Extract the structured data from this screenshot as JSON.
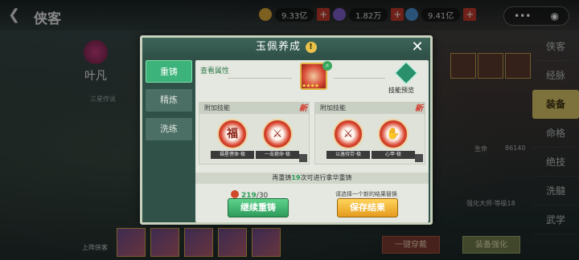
{
  "header": {
    "back_glyph": "❮",
    "title": "侠客",
    "resources": [
      {
        "name": "coin",
        "amount": "9.33亿",
        "color": "#d8a637"
      },
      {
        "name": "gem",
        "amount": "1.82万",
        "color": "#7a5cc8"
      },
      {
        "name": "jade",
        "amount": "9.41亿",
        "color": "#4b8fd1"
      }
    ],
    "plus_glyph": "+",
    "capsule_dots": "•••",
    "capsule_circle": "◉"
  },
  "right_tabs": [
    "侠客",
    "经脉",
    "装备",
    "命格",
    "绝技",
    "洗髓",
    "武学"
  ],
  "right_active": "装备",
  "hero": {
    "name": "叶凡",
    "subtitle": "三星传说"
  },
  "background_labels": {
    "stat": "生命",
    "stat_value": "86140",
    "master": "强化大师·等级18",
    "bottom_label": "上阵侠客",
    "one_key": "一键穿戴",
    "equip_strengthen": "装备强化"
  },
  "modal": {
    "title": "玉佩养成",
    "help": "!",
    "close": "✕",
    "tabs": [
      "重铸",
      "精炼",
      "洗练"
    ],
    "active_tab": "重铸",
    "original_attr": "查看属性",
    "item_stars": "★★★★",
    "skill_preview": "技能预览",
    "left_skill_header": "附加技能",
    "right_skill_header": "附加技能",
    "new_tag": "新",
    "left_skills": [
      {
        "glyph": "福",
        "label": "福星傍体·极"
      },
      {
        "glyph": "⚔",
        "label": "一击毙命·极"
      }
    ],
    "right_skills": [
      {
        "glyph": "⚔",
        "label": "以逸待劳·极"
      },
      {
        "glyph": "✋",
        "label": "心甲·极"
      }
    ],
    "refine_note_prefix": "再重铸",
    "refine_note_num": "19",
    "refine_note_suffix": "次可进行拿华重铸",
    "cost_have": "219",
    "cost_need": "/30",
    "hint": "请选择一个新的结果替换",
    "continue_button": "继续重铸",
    "save_button": "保存结果"
  }
}
